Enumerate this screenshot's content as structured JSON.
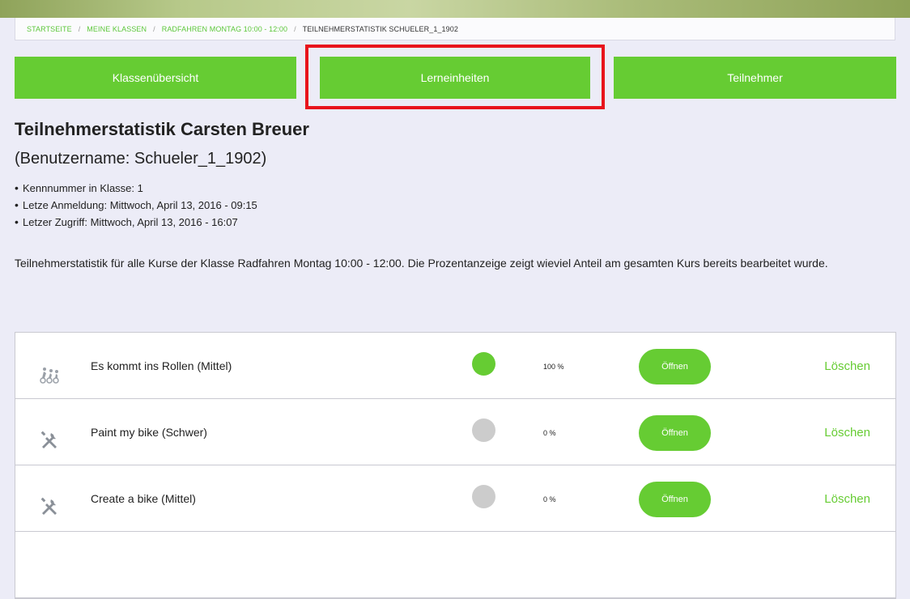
{
  "breadcrumb": {
    "items": [
      "STARTSEITE",
      "MEINE KLASSEN",
      "RADFAHREN MONTAG 10:00 - 12:00"
    ],
    "current": "TEILNEHMERSTATISTIK SCHUELER_1_1902",
    "separator": "/"
  },
  "tabs": [
    {
      "label": "Klassenübersicht"
    },
    {
      "label": "Lerneinheiten"
    },
    {
      "label": "Teilnehmer"
    }
  ],
  "title": "Teilnehmerstatistik Carsten Breuer",
  "subtitle": "(Benutzername: Schueler_1_1902)",
  "info": [
    "Kennnummer in Klasse: 1",
    "Letze Anmeldung: Mittwoch, April 13, 2016 - 09:15",
    "Letzer Zugriff: Mittwoch, April 13, 2016 - 16:07"
  ],
  "description": "Teilnehmerstatistik für alle Kurse der Klasse Radfahren Montag 10:00 - 12:00. Die Prozentanzeige zeigt wieviel Anteil am gesamten Kurs bereits bearbeitet wurde.",
  "courses": [
    {
      "name": "Es kommt ins Rollen (Mittel)",
      "icon": "cyclists-icon",
      "progress": 1.0,
      "percent_label": "100 %",
      "status_color": "#66cc33",
      "open_label": "Öffnen",
      "delete_label": "Löschen"
    },
    {
      "name": "Paint my bike (Schwer)",
      "icon": "tools-icon",
      "progress": 0.0,
      "percent_label": "0 %",
      "status_color": "#cccccc",
      "open_label": "Öffnen",
      "delete_label": "Löschen"
    },
    {
      "name": "Create a bike (Mittel)",
      "icon": "tools-icon",
      "progress": 0.0,
      "percent_label": "0 %",
      "status_color": "#cccccc",
      "open_label": "Öffnen",
      "delete_label": "Löschen"
    }
  ],
  "colors": {
    "accent": "#66cc33",
    "highlight": "#e8141c",
    "background": "#ececf7"
  }
}
